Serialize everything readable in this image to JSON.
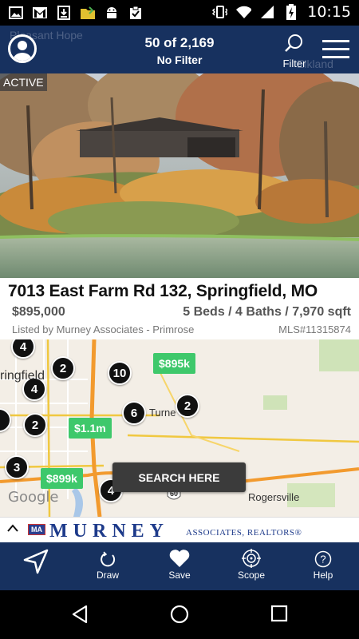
{
  "status_bar": {
    "time": "10:15",
    "left_icons": [
      "gallery-icon",
      "gmail-icon",
      "download-icon",
      "folder-icon",
      "android-icon",
      "clipboard-check-icon"
    ],
    "right_icons": [
      "vibrate-icon",
      "wifi-icon",
      "signal-icon",
      "battery-charging-icon"
    ]
  },
  "header": {
    "count": "50 of 2,169",
    "filter_status": "No Filter",
    "filter_label": "Filter",
    "map_ghost_left": "Pleasant Hope",
    "map_ghost_right": "Elkland"
  },
  "listing": {
    "status_badge": "ACTIVE",
    "address": "7013 East Farm Rd 132, Springfield, MO",
    "price": "$895,000",
    "specs": "5 Beds / 4 Baths / 7,970 sqft",
    "listed_by": "Listed by Murney Associates - Primrose",
    "mls": "MLS#11315874"
  },
  "map": {
    "clusters": [
      "4",
      "2",
      "4",
      "10",
      "6",
      "2",
      "2",
      "3",
      "4"
    ],
    "price_pins": [
      "$895k",
      "$1.1m",
      "$899k"
    ],
    "labels": {
      "springfield": "ringfield",
      "turner": "Turne",
      "rogersville": "Rogersville",
      "highway": "60"
    },
    "search_here_label": "SEARCH HERE",
    "attribution": "Google"
  },
  "brand": {
    "logo_text": "MA",
    "name": "MURNEY",
    "sub": "ASSOCIATES, REALTORS®"
  },
  "toolbar": {
    "items": [
      {
        "label": "",
        "icon": "navigation-arrow-icon"
      },
      {
        "label": "Draw",
        "icon": "draw-icon"
      },
      {
        "label": "Save",
        "icon": "heart-icon"
      },
      {
        "label": "Scope",
        "icon": "scope-icon"
      },
      {
        "label": "Help",
        "icon": "help-icon"
      }
    ]
  },
  "colors": {
    "header_bg": "#17315f",
    "price_pin": "#3ec86b",
    "brand_blue": "#1d3a8a"
  }
}
